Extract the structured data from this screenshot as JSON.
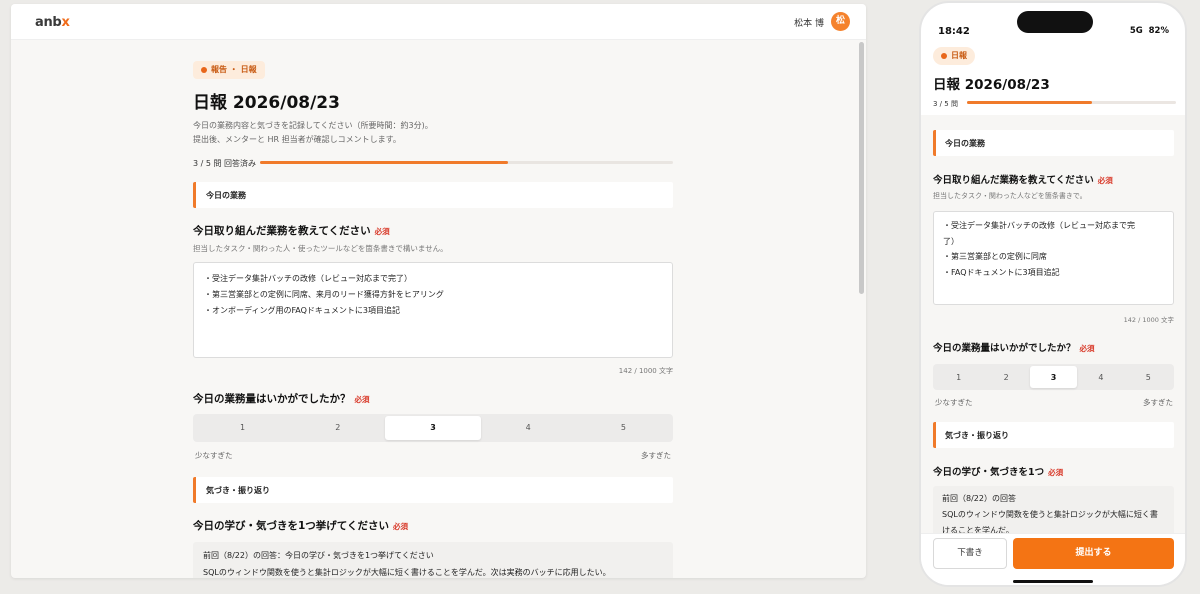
{
  "desktop": {
    "header": {
      "logo_main": "anb",
      "logo_accent": "x",
      "user_name": "松本 博",
      "avatar_initial": "松"
    },
    "category_chip": "報告 ・ 日報",
    "title": "日報 2026/08/23",
    "description_line1": "今日の業務内容と気づきを記録してください（所要時間：約3分)。",
    "description_line2": "提出後、メンターと HR 担当者が確認しコメントします。",
    "progress": {
      "label": "3 / 5 問 回答済み",
      "fraction": 0.6
    },
    "section1": "今日の業務",
    "q1": {
      "label": "今日取り組んだ業務を教えてください",
      "required": "必須",
      "hint": "担当したタスク・関わった人・使ったツールなどを箇条書きで構いません。",
      "lines": [
        "・受注データ集計バッチの改修（レビュー対応まで完了）",
        "・第三営業部との定例に同席、来月のリード獲得方針をヒアリング",
        "・オンボーディング用のFAQドキュメントに3項目追記"
      ],
      "counter": "142 / 1000 文字"
    },
    "q2": {
      "label": "今日の業務量はいかがでしたか？",
      "required": "必須",
      "options": [
        "1",
        "2",
        "3",
        "4",
        "5"
      ],
      "selected": 3,
      "low_label": "少なすぎた",
      "high_label": "多すぎた"
    },
    "section2": "気づき・振り返り",
    "q3": {
      "label": "今日の学び・気づきを1つ挙げてください",
      "required": "必須",
      "prev_title": "前回（8/22）の回答：今日の学び・気づきを1つ挙げてください",
      "prev_text": "SQLのウィンドウ関数を使うと集計ロジックが大幅に短く書けることを学んだ。次は実務のバッチに応用したい。"
    }
  },
  "phone": {
    "time": "18:42",
    "network": "5G",
    "battery": "82%",
    "chip": "日報",
    "title": "日報 2026/08/23",
    "progress_label": "3 / 5 問",
    "progress_fraction": 0.6,
    "section1": "今日の業務",
    "q1_label": "今日取り組んだ業務を教えてください",
    "q1_required": "必須",
    "q1_hint": "担当したタスク・関わった人などを箇条書きで。",
    "q1_lines": [
      "・受注データ集計バッチの改修（レビュー対応まで完",
      "了）",
      "・第三営業部との定例に同席",
      "・FAQドキュメントに3項目追記"
    ],
    "q1_counter": "142 / 1000 文字",
    "q2_label": "今日の業務量はいかがでしたか？",
    "q2_required": "必須",
    "q2_options": [
      "1",
      "2",
      "3",
      "4",
      "5"
    ],
    "q2_low": "少なすぎた",
    "q2_high": "多すぎた",
    "section2": "気づき・振り返り",
    "q3_label": "今日の学び・気づきを1つ",
    "q3_required": "必須",
    "q3_prev_title": "前回（8/22）の回答",
    "q3_prev_text": "SQLのウィンドウ関数を使うと集計ロジックが大幅に短く書けることを学んだ。",
    "draft_button": "下書き",
    "submit_button": "提出する"
  },
  "colors": {
    "accent": "#f07a2a",
    "required": "#d93a2a",
    "submit": "#f47414"
  }
}
